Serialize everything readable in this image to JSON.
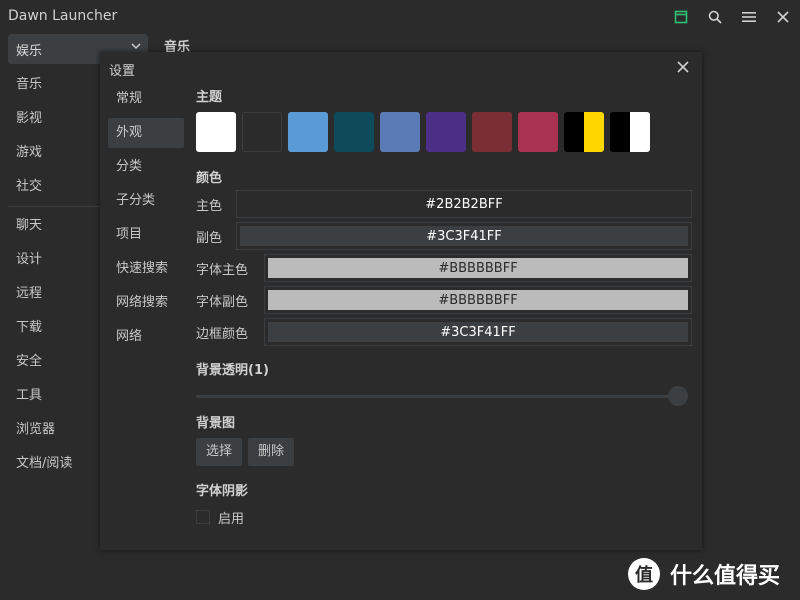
{
  "app": {
    "title": "Dawn Launcher"
  },
  "titlebar": {
    "icons": [
      "panel-icon",
      "search-icon",
      "menu-icon",
      "close-icon"
    ],
    "accent": "#2fbf71"
  },
  "sidebar": {
    "selected_category": "娱乐",
    "items": [
      "音乐",
      "影视",
      "游戏",
      "社交",
      "聊天",
      "设计",
      "远程",
      "下载",
      "安全",
      "工具",
      "浏览器",
      "文档/阅读"
    ]
  },
  "main": {
    "subcategory_heading": "音乐"
  },
  "settings": {
    "title": "设置",
    "nav": [
      "常规",
      "外观",
      "分类",
      "子分类",
      "项目",
      "快速搜索",
      "网络搜索",
      "网络"
    ],
    "active_nav": "外观",
    "theme": {
      "title": "主题",
      "swatches": [
        [
          "#ffffff"
        ],
        [
          "#2b2b2b"
        ],
        [
          "#5b9bd5"
        ],
        [
          "#0e4a5a"
        ],
        [
          "#5a7bb5"
        ],
        [
          "#4b2f86"
        ],
        [
          "#7a2f35"
        ],
        [
          "#a83250"
        ],
        [
          "#000000",
          "#ffd700"
        ],
        [
          "#000000",
          "#ffffff"
        ]
      ]
    },
    "colors": {
      "title": "颜色",
      "rows": [
        {
          "label": "主色",
          "value": "#2B2B2BFF",
          "swatch": "#2b2b2b",
          "text": "#ffffff"
        },
        {
          "label": "副色",
          "value": "#3C3F41FF",
          "swatch": "#3c3f41",
          "text": "#ffffff"
        },
        {
          "label": "字体主色",
          "value": "#BBBBBBFF",
          "swatch": "#bbbbbb",
          "text": "#2b2b2b"
        },
        {
          "label": "字体副色",
          "value": "#BBBBBBFF",
          "swatch": "#bbbbbb",
          "text": "#2b2b2b"
        },
        {
          "label": "边框颜色",
          "value": "#3C3F41FF",
          "swatch": "#3c3f41",
          "text": "#ffffff"
        }
      ]
    },
    "opacity": {
      "title": "背景透明(1)",
      "value": 1
    },
    "background_image": {
      "title": "背景图",
      "select_label": "选择",
      "delete_label": "删除"
    },
    "font_shadow": {
      "title": "字体阴影",
      "enable_label": "启用",
      "checked": false
    }
  },
  "watermark": {
    "logo": "值",
    "text": "什么值得买"
  }
}
